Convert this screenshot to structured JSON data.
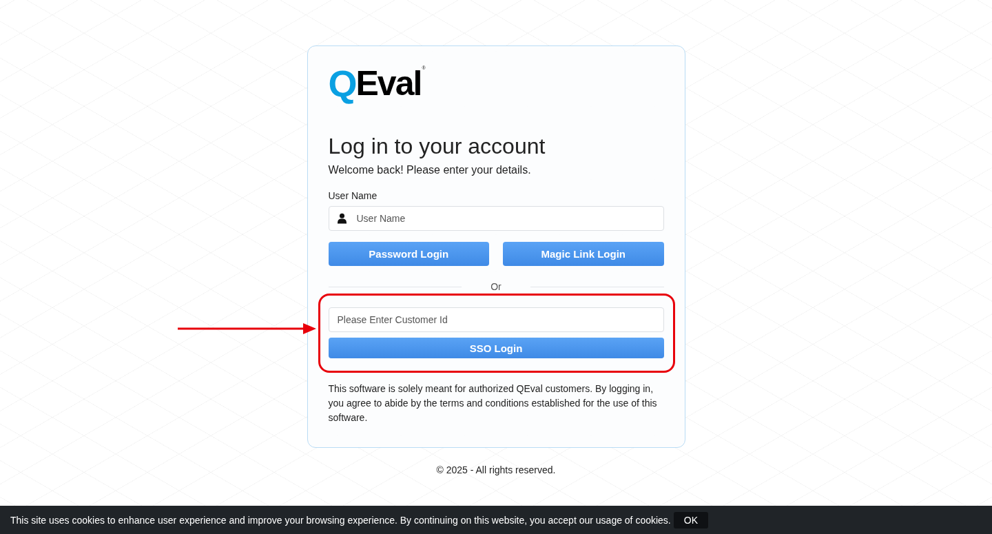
{
  "logo": {
    "mark": "Q",
    "text": "Eval",
    "registered": "®"
  },
  "title": "Log in to your account",
  "subtitle": "Welcome back! Please enter your details.",
  "username": {
    "label": "User Name",
    "placeholder": "User Name"
  },
  "login_buttons": [
    "Password Login",
    "Magic Link Login"
  ],
  "divider": "Or",
  "sso": {
    "placeholder": "Please Enter Customer Id",
    "button": "SSO Login",
    "highlighted": true
  },
  "notice": "This software is solely meant for authorized QEval customers. By logging in, you agree to abide by the terms and conditions established for the use of this software.",
  "footer": "© 2025 - All rights reserved.",
  "cookie_bar": {
    "text": "This site uses cookies to enhance user experience and improve your browsing experience. By continuing on this website, you accept our usage of cookies.",
    "button": "OK"
  }
}
